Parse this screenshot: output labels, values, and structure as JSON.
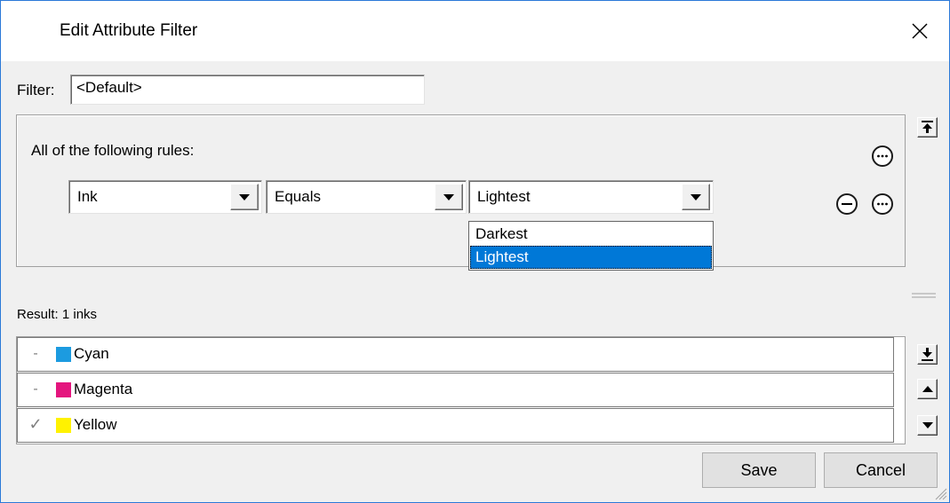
{
  "window": {
    "title": "Edit Attribute Filter"
  },
  "filter": {
    "label": "Filter:",
    "value": "<Default>"
  },
  "rules": {
    "heading": "All of the following rules:",
    "rule": {
      "attribute": "Ink",
      "operator": "Equals",
      "value": "Lightest"
    },
    "dropdown_options": [
      "Darkest",
      "Lightest"
    ],
    "selected_option": "Lightest"
  },
  "result": {
    "label": "Result: 1 inks"
  },
  "inks": [
    {
      "name": "Cyan",
      "color": "#1c9be0",
      "mark": "-"
    },
    {
      "name": "Magenta",
      "color": "#e4157e",
      "mark": "-"
    },
    {
      "name": "Yellow",
      "color": "#fff200",
      "mark": "✓"
    }
  ],
  "buttons": {
    "save": "Save",
    "cancel": "Cancel"
  },
  "colors": {
    "accent": "#0078d7",
    "window_border": "#2b79d8"
  }
}
